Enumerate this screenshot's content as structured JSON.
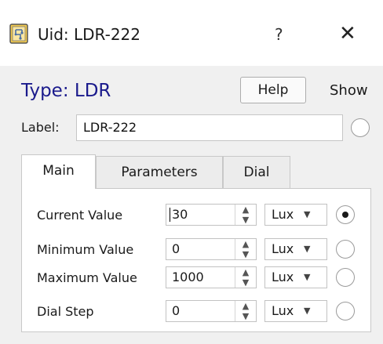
{
  "window": {
    "title": "Uid: LDR-222",
    "help_glyph": "?",
    "close_glyph": "✕",
    "app_icon": "circuit-board-icon"
  },
  "header": {
    "type_title": "Type: LDR",
    "help_button": "Help",
    "show_label": "Show"
  },
  "label_row": {
    "caption": "Label:",
    "value": "LDR-222"
  },
  "tabs": [
    {
      "label": "Main",
      "active": true
    },
    {
      "label": "Parameters",
      "active": false
    },
    {
      "label": "Dial",
      "active": false
    }
  ],
  "rows": [
    {
      "label": "Current Value",
      "value": "30",
      "unit": "Lux",
      "selected": true
    },
    {
      "label": "Minimum Value",
      "value": "0",
      "unit": "Lux",
      "selected": false
    },
    {
      "label": "Maximum Value",
      "value": "1000",
      "unit": "Lux",
      "selected": false
    },
    {
      "label": "Dial Step",
      "value": "0",
      "unit": "Lux",
      "selected": false
    }
  ],
  "colors": {
    "type_title": "#1a1a8c",
    "titlebar_bg": "#ffffff",
    "window_bg": "#f0f0f0"
  }
}
